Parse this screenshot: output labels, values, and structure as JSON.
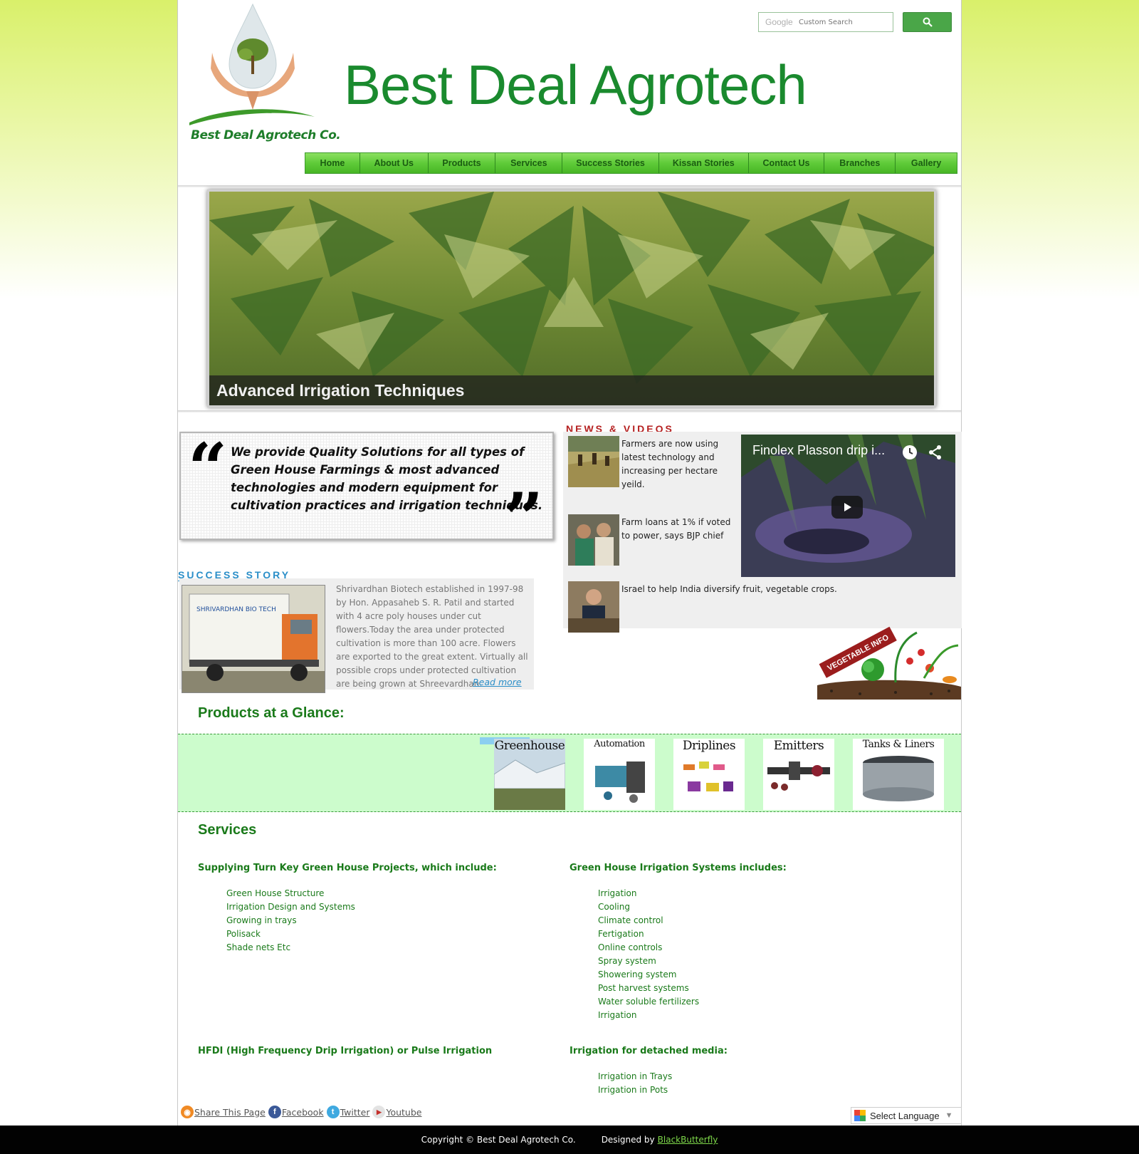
{
  "header": {
    "logo_caption": "Best Deal Agrotech Co.",
    "site_title": "Best Deal Agrotech",
    "search_placeholder": "Custom Search",
    "search_brand": "Google"
  },
  "nav": {
    "items": [
      "Home",
      "About Us",
      "Products",
      "Services",
      "Success Stories",
      "Kissan Stories",
      "Contact Us",
      "Branches",
      "Gallery"
    ]
  },
  "banner": {
    "caption": "Advanced Irrigation Techniques"
  },
  "quote": {
    "text": "We provide Quality Solutions for all types of Green House Farmings & most advanced technologies and modern equipment for cultivation practices and irrigation techniques."
  },
  "success": {
    "heading": "SUCCESS STORY",
    "text": "Shrivardhan Biotech established in 1997-98 by Hon. Appasaheb S. R. Patil and started with 4 acre poly houses under cut flowers.Today the area under protected cultivation is more than 100 acre. Flowers are exported to the great extent. Virtually all possible crops under protected cultivation are being grown at Shreevardhan.",
    "read_more": "Read more",
    "image_label": "SHRIVARDHAN BIO TECH"
  },
  "news": {
    "heading": "NEWS & VIDEOS",
    "items": [
      "Farmers are now using latest technology and increasing per hectare yeild.",
      "Farm loans at 1% if voted to power, says BJP chief",
      "Israel to help India diversify fruit, vegetable crops."
    ],
    "video_title": "Finolex Plasson drip i...",
    "veg_badge": "VEGETABLE INFO"
  },
  "products": {
    "heading": "Products at a Glance:",
    "items": [
      "Greenhouse",
      "Automation",
      "Driplines",
      "Emitters",
      "Tanks & Liners"
    ]
  },
  "services": {
    "heading": "Services",
    "col1_heading": "Supplying Turn Key Green House Projects, which include:",
    "col1_items": [
      "Green House Structure",
      "Irrigation Design and Systems",
      "Growing in trays",
      "Polisack",
      "Shade nets Etc"
    ],
    "col2_heading": "Green House Irrigation Systems includes:",
    "col2_items": [
      "Irrigation",
      "Cooling",
      "Climate control",
      "Fertigation",
      "Online controls",
      "Spray system",
      "Showering system",
      "Post harvest systems",
      "Water soluble fertilizers",
      "Irrigation"
    ],
    "col3_heading": "HFDI (High Frequency Drip Irrigation) or Pulse Irrigation",
    "col4_heading": "Irrigation for detached media:",
    "col4_items": [
      "Irrigation in Trays",
      "Irrigation in Pots"
    ]
  },
  "social": {
    "share": "Share This Page",
    "facebook": "Facebook",
    "twitter": "Twitter",
    "youtube": "Youtube"
  },
  "language": {
    "label": "Select Language"
  },
  "footer": {
    "copyright": "Copyright © Best Deal Agrotech Co.",
    "designed_by": "Designed by",
    "designer": "BlackButterfly"
  }
}
